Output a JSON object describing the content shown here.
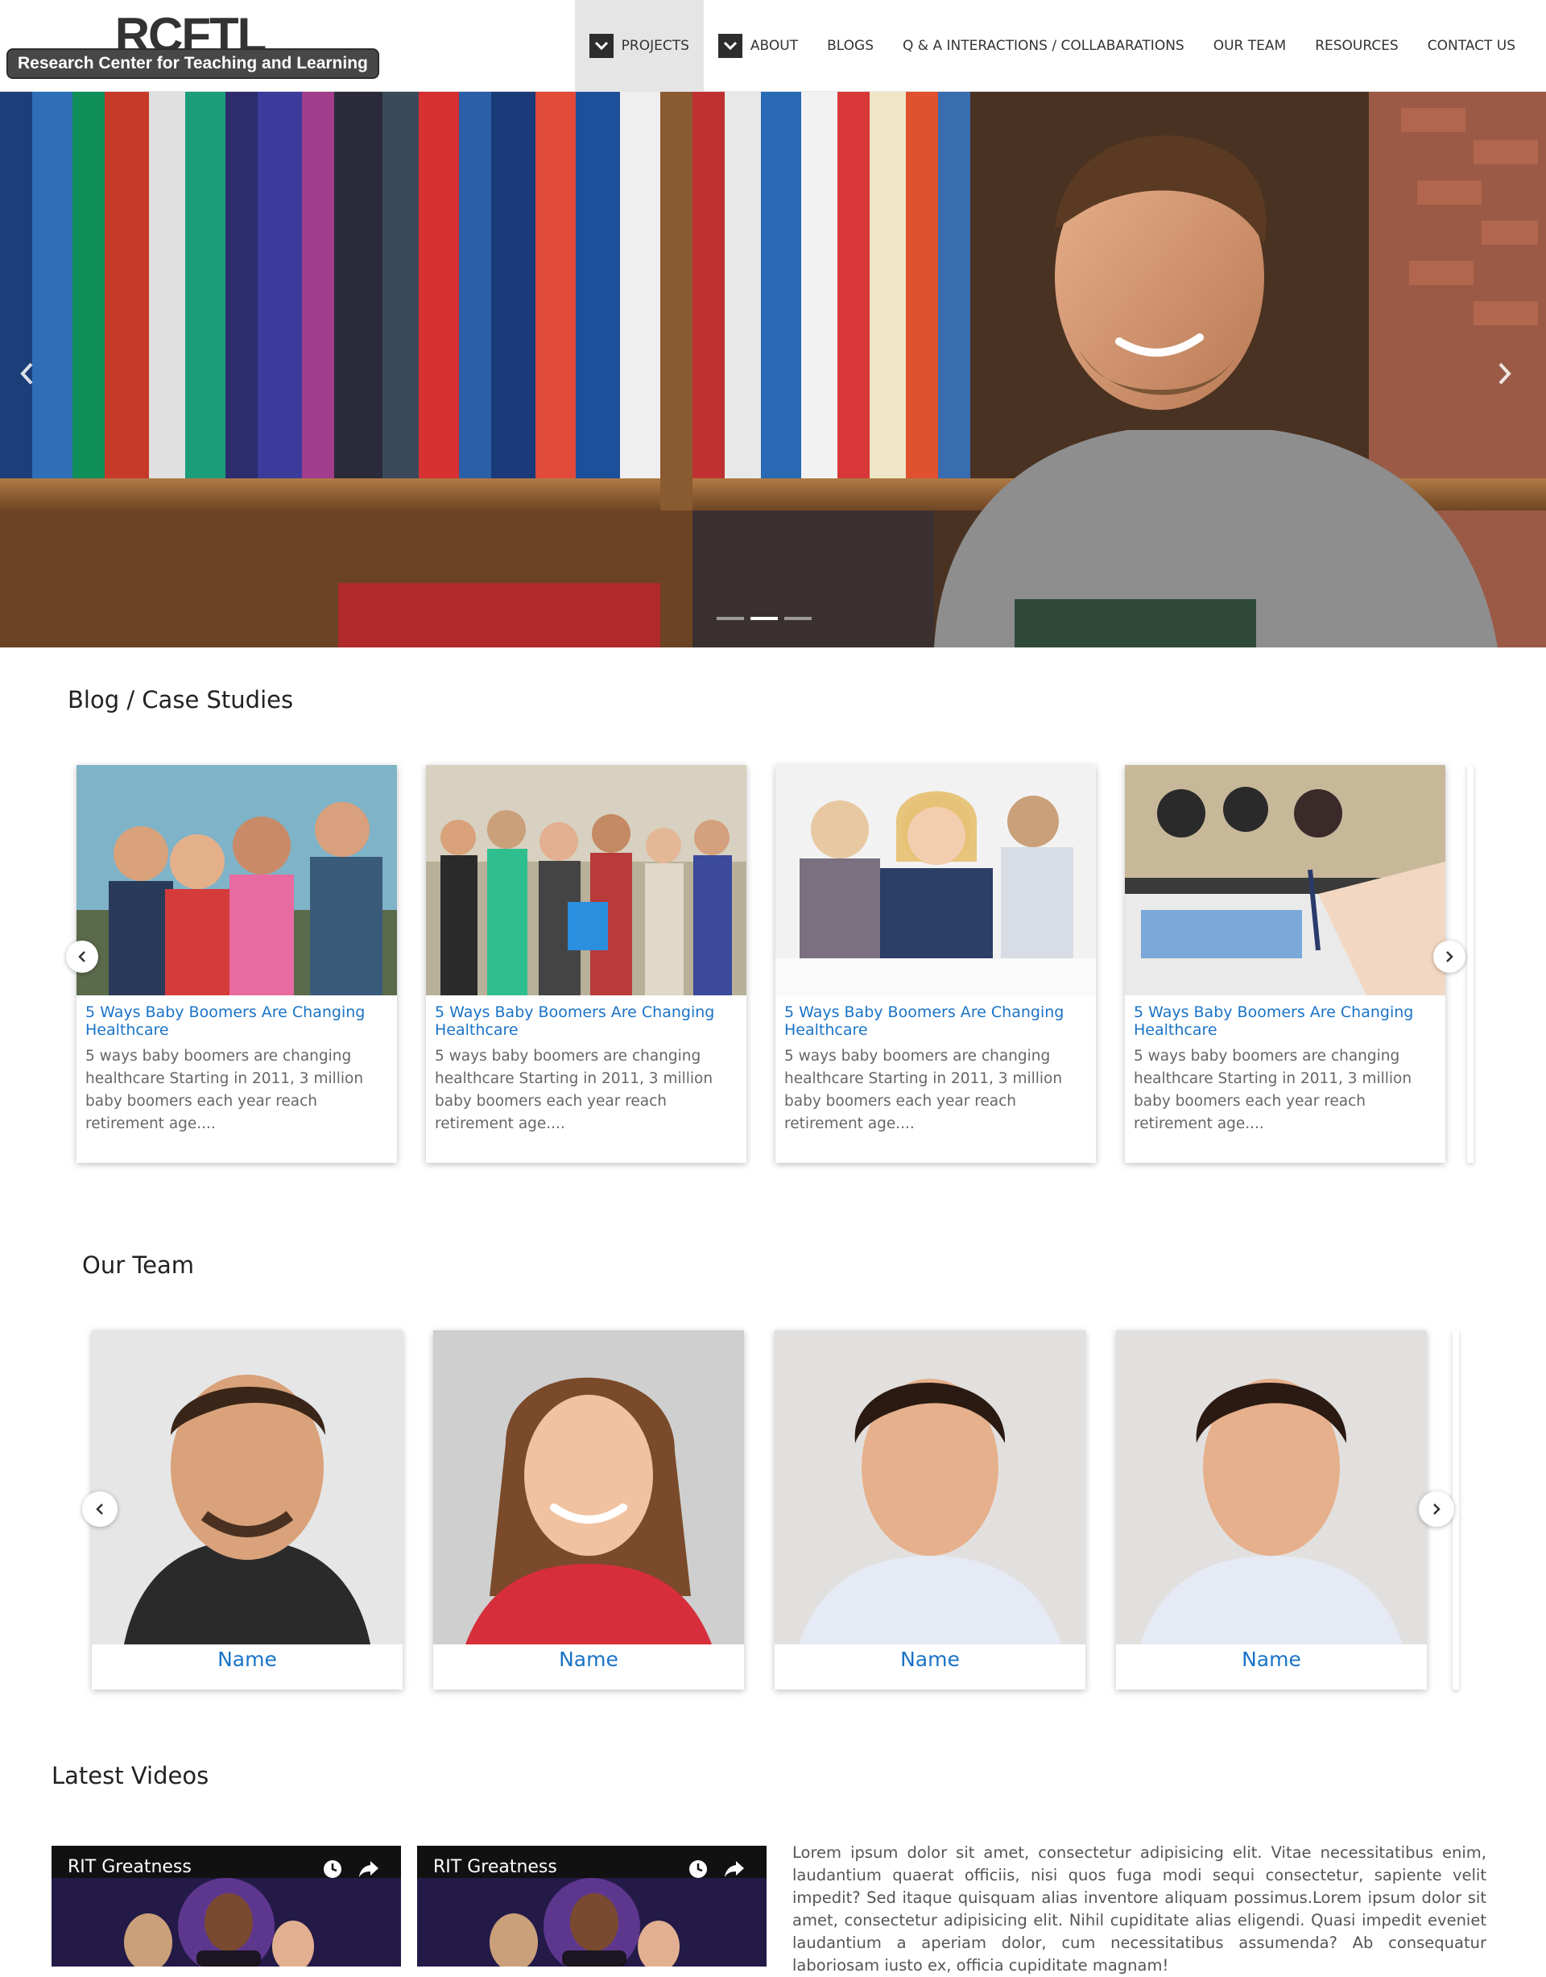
{
  "brand": {
    "logo_text": "RCFTL",
    "tagline": "Research Center for Teaching and Learning"
  },
  "nav": {
    "projects": "PROJECTS",
    "about": "ABOUT",
    "blogs": "BLOGS",
    "qa": "Q & A INTERACTIONS / COLLABARATIONS",
    "team": "OUR TEAM",
    "resources": "RESOURCES",
    "contact": "CONTACT US"
  },
  "hero": {
    "slide_count": 3,
    "active_slide": 2
  },
  "blog": {
    "heading": "Blog / Case Studies",
    "cards": [
      {
        "title": "5 Ways Baby Boomers Are Changing Healthcare",
        "excerpt": "5 ways baby boomers are changing healthcare Starting in 2011, 3 million baby boomers each year reach retirement age...."
      },
      {
        "title": "5 Ways Baby Boomers Are Changing Healthcare",
        "excerpt": "5 ways baby boomers are changing healthcare Starting in 2011, 3 million baby boomers each year reach retirement age...."
      },
      {
        "title": "5 Ways Baby Boomers Are Changing Healthcare",
        "excerpt": "5 ways baby boomers are changing healthcare Starting in 2011, 3 million baby boomers each year reach retirement age...."
      },
      {
        "title": "5 Ways Baby Boomers Are Changing Healthcare",
        "excerpt": "5 ways baby boomers are changing healthcare Starting in 2011, 3 million baby boomers each year reach retirement age...."
      }
    ]
  },
  "team": {
    "heading": "Our Team",
    "members": [
      {
        "name": "Name"
      },
      {
        "name": "Name"
      },
      {
        "name": "Name"
      },
      {
        "name": "Name"
      }
    ]
  },
  "videos": {
    "heading": "Latest Videos",
    "items": [
      {
        "title": "RIT Greatness"
      },
      {
        "title": "RIT Greatness"
      }
    ],
    "description": "Lorem ipsum dolor sit amet, consectetur adipisicing elit. Vitae necessitatibus enim, laudantium quaerat officiis, nisi quos fuga modi sequi consectetur, sapiente velit impedit? Sed itaque quisquam alias inventore aliquam possimus.Lorem ipsum dolor sit amet, consectetur adipisicing elit. Nihil cupiditate alias eligendi. Quasi impedit eveniet laudantium a aperiam dolor, cum necessitatibus assumenda? Ab consequatur laboriosam iusto ex, officia cupiditate magnam!"
  },
  "colors": {
    "link_blue": "#1a73c7",
    "logo_tag_bg": "#474747",
    "nav_active_bg": "#e5e5e5"
  }
}
